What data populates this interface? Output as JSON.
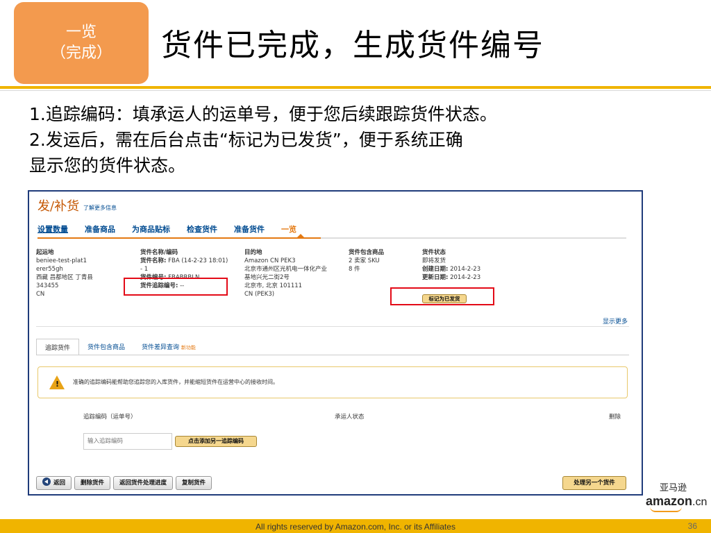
{
  "slide": {
    "section_tag": {
      "line1": "一览",
      "line2": "（完成）"
    },
    "title": "货件已完成，生成货件编号",
    "notes": [
      "1.追踪编码：填承运人的运单号，便于您后续跟踪货件状态。",
      "2.发运后，需在后台点击“标记为已发货”，便于系统正确",
      "显示您的货件状态。"
    ],
    "footer": "All rights reserved by Amazon.com, Inc. or its Affiliates",
    "page_number": "36",
    "logo": {
      "cn_mark": "亚马逊",
      "word": "amazon",
      "suffix": ".cn"
    },
    "accent_color": "#f0b400",
    "tag_color": "#f39a4e"
  },
  "screenshot": {
    "page_title": "发/补货",
    "learn_more": "了解更多信息",
    "steps": [
      "设置数量",
      "准备商品",
      "为商品贴标",
      "检查货件",
      "准备货件",
      "一览"
    ],
    "ship_from": {
      "header": "起运地",
      "lines": [
        "beniee-test-plat1",
        "erer55gh",
        "西藏 昌都地区 丁青县",
        "343455",
        "CN"
      ]
    },
    "shipment": {
      "header": "货件名称/编码",
      "name_label": "货件名称:",
      "name_value": "FBA (14-2-23 18:01)",
      "name_suffix": "- 1",
      "id_label": "货件编号:",
      "id_value": "FBABRBLN",
      "tracking_label": "货件追踪编号:",
      "tracking_value": "--"
    },
    "destination": {
      "header": "目的地",
      "lines": [
        "Amazon CN PEK3",
        "北京市通州区光机电一体化产业",
        "基地兴光二街2号",
        "北京市, 北京 101111",
        "CN (PEK3)"
      ]
    },
    "contents": {
      "header": "货件包含商品",
      "lines": [
        "2 卖家 SKU",
        "8 件"
      ]
    },
    "status": {
      "header": "货件状态",
      "state": "即将发货",
      "created_label": "创建日期:",
      "created_value": "2014-2-23",
      "updated_label": "更新日期:",
      "updated_value": "2014-2-23",
      "mark_shipped_button": "标记为已发货"
    },
    "show_more": "显示更多",
    "tabs": [
      {
        "label": "追踪货件"
      },
      {
        "label": "货件包含商品"
      },
      {
        "label": "货件差异查询",
        "badge": "新功能"
      }
    ],
    "alert_text": "准确的追踪编码能帮助您追踪您的入库货件，并能缩短货件在运营中心的接收时间。",
    "tracking_table": {
      "col_code": "追踪编码（运单号）",
      "col_status": "承运人状态",
      "col_delete": "删除",
      "input_placeholder": "输入追踪编码",
      "add_button": "点击添加另一追踪编码"
    },
    "bottom_buttons": [
      "返回",
      "删除货件",
      "返回货件处理进度",
      "复制货件"
    ],
    "next_button": "处理另一个货件"
  }
}
